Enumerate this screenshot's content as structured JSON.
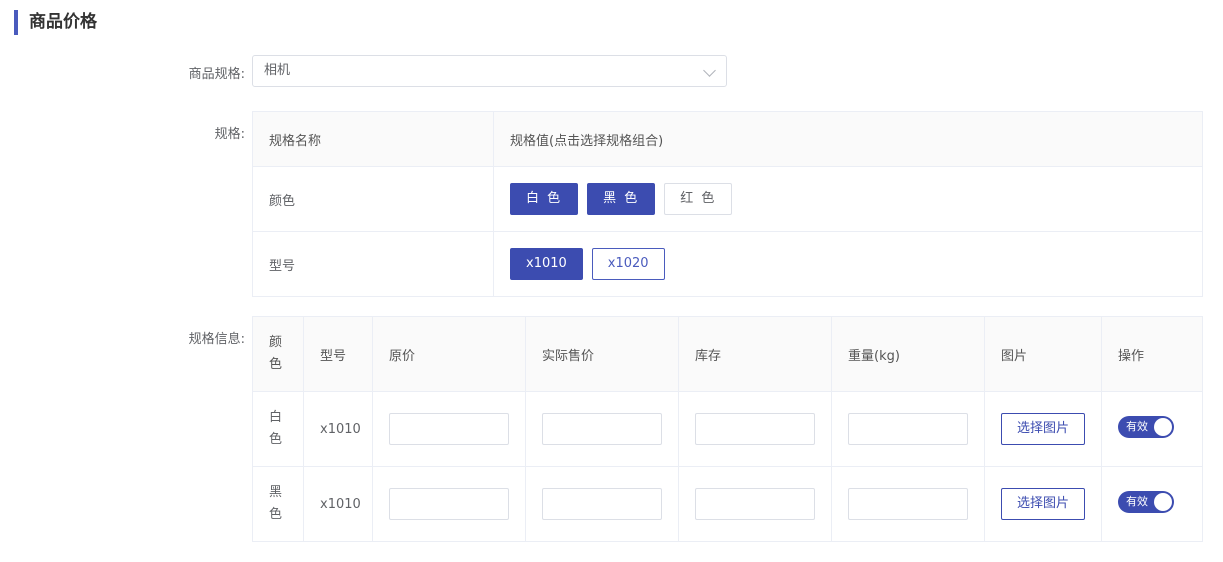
{
  "section": {
    "title": "商品价格"
  },
  "form": {
    "spec_label": "商品规格:",
    "spec_value": "相机",
    "specs_label": "规格:",
    "spec_info_label": "规格信息:"
  },
  "spec_table": {
    "headers": [
      "规格名称",
      "规格值(点击选择规格组合)"
    ],
    "rows": [
      {
        "name": "颜色",
        "values": [
          {
            "label": "白 色",
            "selected": true
          },
          {
            "label": "黑 色",
            "selected": true
          },
          {
            "label": "红 色",
            "selected": false
          }
        ]
      },
      {
        "name": "型号",
        "values": [
          {
            "label": "x1010",
            "selected": true
          },
          {
            "label": "x1020",
            "selected": false
          }
        ]
      }
    ]
  },
  "info_table": {
    "headers": [
      "颜色",
      "型号",
      "原价",
      "实际售价",
      "库存",
      "重量(kg)",
      "图片",
      "操作"
    ],
    "rows": [
      {
        "color": "白色",
        "model": "x1010",
        "pic_button": "选择图片",
        "status": "有效"
      },
      {
        "color": "黑色",
        "model": "x1010",
        "pic_button": "选择图片",
        "status": "有效"
      }
    ]
  },
  "colors": {
    "accent": "#3c4cb0",
    "border": "#ebeef5"
  }
}
